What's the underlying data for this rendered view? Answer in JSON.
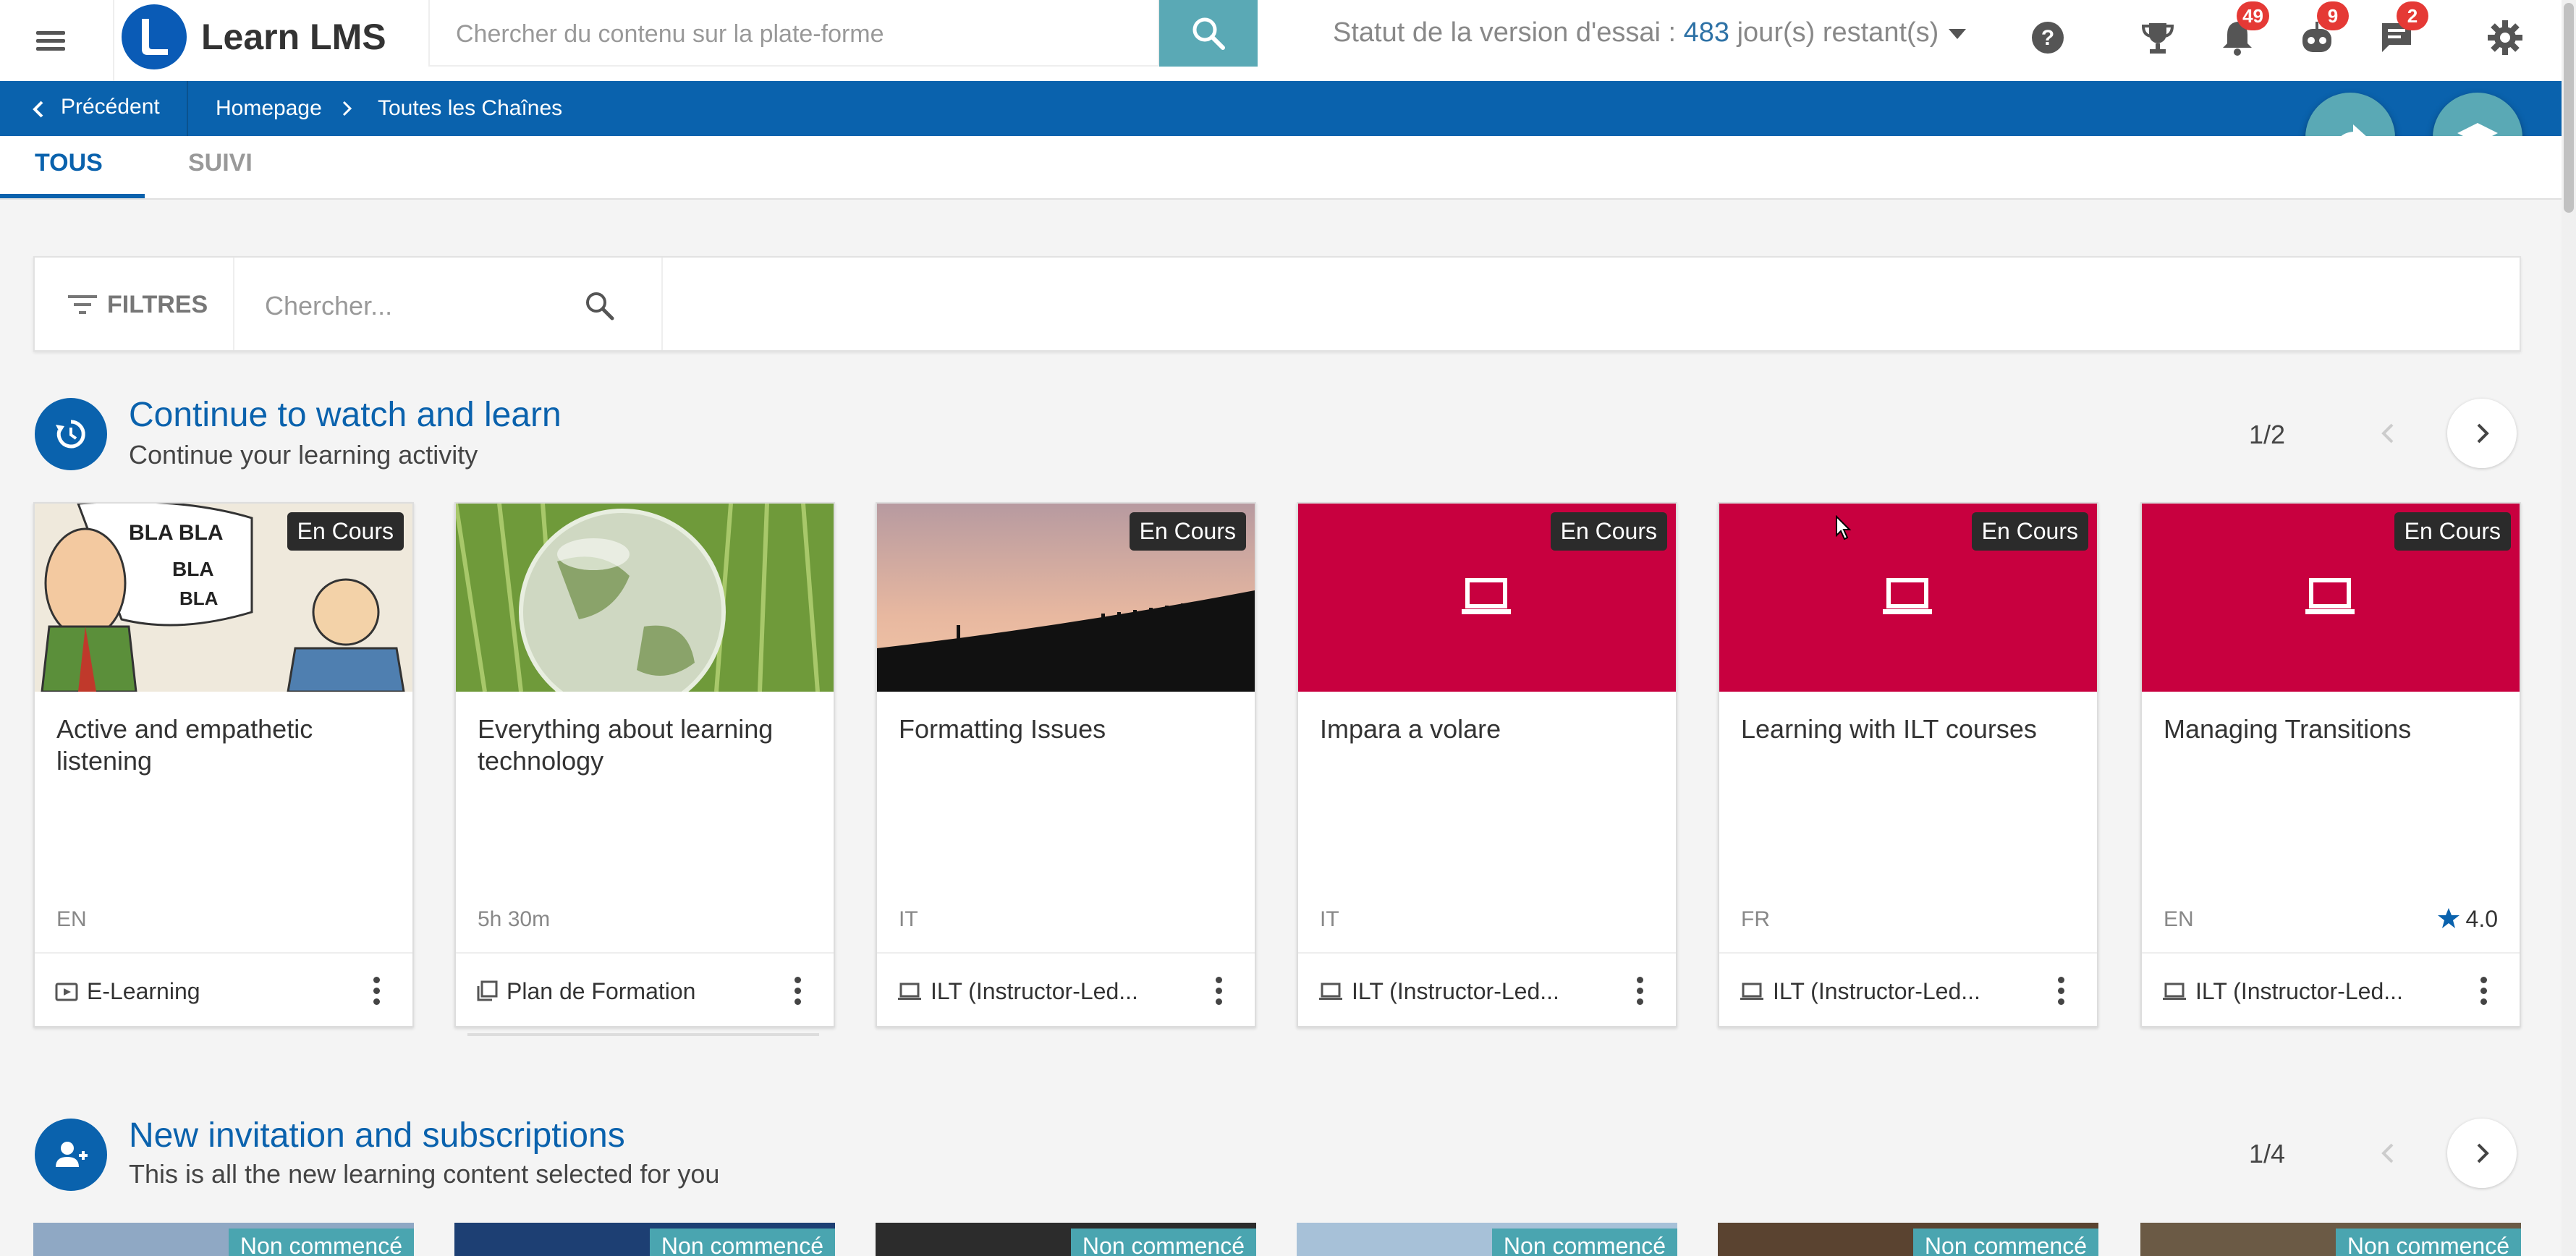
{
  "header": {
    "app_name": "Learn LMS",
    "search_placeholder": "Chercher du contenu sur la plate-forme",
    "trial_prefix": "Statut de la version d'essai : ",
    "trial_days": "483",
    "trial_suffix": " jour(s) restant(s)",
    "notifications_count": "49",
    "bot_count": "9",
    "messages_count": "2"
  },
  "breadcrumb": {
    "back_label": "Précédent",
    "home_label": "Homepage",
    "current_label": "Toutes les Chaînes"
  },
  "tabs": [
    {
      "label": "TOUS",
      "active": true
    },
    {
      "label": "SUIVI",
      "active": false
    }
  ],
  "filters": {
    "button_label": "FILTRES",
    "search_placeholder": "Chercher..."
  },
  "sections": [
    {
      "title": "Continue to watch and learn",
      "subtitle": "Continue your learning activity",
      "pager": "1/2",
      "cards": [
        {
          "title": "Active and empathetic listening",
          "status": "En Cours",
          "meta": "EN",
          "type": "E-Learning",
          "rating": null,
          "thumb": "cartoon"
        },
        {
          "title": "Everything about learning technology",
          "status": null,
          "meta": "5h 30m",
          "type": "Plan de Formation",
          "rating": null,
          "thumb": "globe"
        },
        {
          "title": "Formatting Issues",
          "status": "En Cours",
          "meta": "IT",
          "type": "ILT (Instructor-Led...",
          "rating": null,
          "thumb": "sunset"
        },
        {
          "title": "Impara a volare",
          "status": "En Cours",
          "meta": "IT",
          "type": "ILT (Instructor-Led...",
          "rating": null,
          "thumb": "crimson"
        },
        {
          "title": "Learning with ILT courses",
          "status": "En Cours",
          "meta": "FR",
          "type": "ILT (Instructor-Led...",
          "rating": null,
          "thumb": "crimson"
        },
        {
          "title": "Managing Transitions",
          "status": "En Cours",
          "meta": "EN",
          "type": "ILT (Instructor-Led...",
          "rating": "4.0",
          "thumb": "crimson"
        }
      ]
    },
    {
      "title": "New invitation and subscriptions",
      "subtitle": "This is all the new learning content selected for you",
      "pager": "1/4",
      "badge": "Non commencé"
    }
  ],
  "colors": {
    "brand_blue": "#0a62ad",
    "teal": "#5aa9b5",
    "crimson": "#c8003f",
    "badge_red": "#e53935"
  }
}
